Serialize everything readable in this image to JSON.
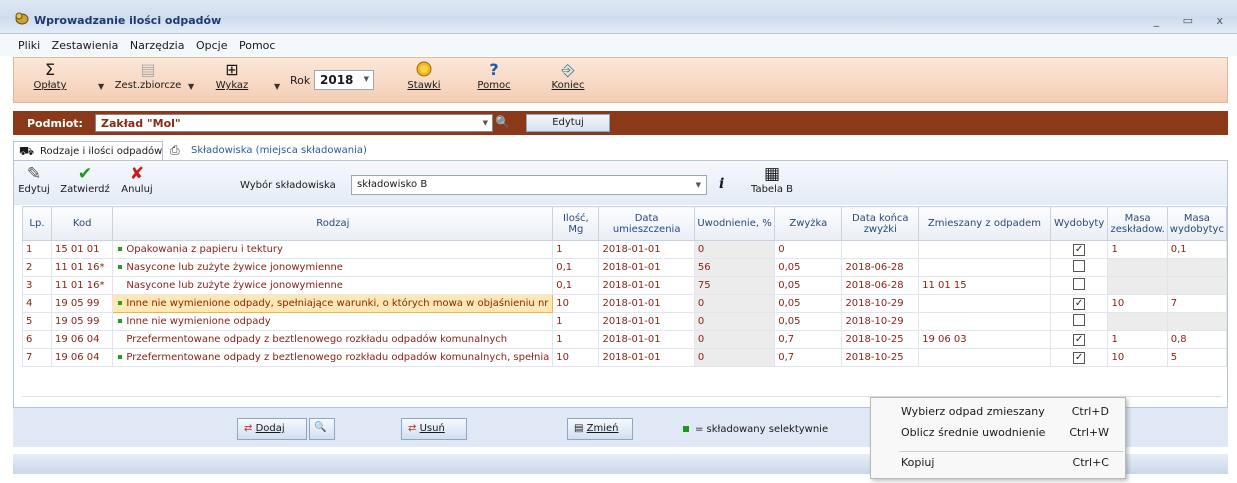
{
  "window": {
    "title": "Wprowadzanie ilości odpadów",
    "controls": "_ ▭ x"
  },
  "menu": [
    "Pliki",
    "Zestawienia",
    "Narzędzia",
    "Opcje",
    "Pomoc"
  ],
  "toolbar": {
    "oplaty": "Opłaty",
    "zest": "Zest.zbiorcze",
    "wykaz": "Wykaz",
    "rok_label": "Rok",
    "rok_value": "2018",
    "stawki": "Stawki",
    "pomoc": "Pomoc",
    "koniec": "Koniec"
  },
  "podmiot": {
    "label": "Podmiot:",
    "value": "Zakład \"Mol\"",
    "edit_btn": "Edytuj"
  },
  "tabs": [
    "Rodzaje i ilości odpadów",
    "Składowiska (miejsca składowania)"
  ],
  "subtoolbar": {
    "edytuj": "Edytuj",
    "zatwierdz": "Zatwierdź",
    "anuluj": "Anuluj",
    "wybor_label": "Wybór składowiska",
    "wybor_value": "składowisko B",
    "tabela": "Tabela B"
  },
  "table": {
    "headers": [
      "Lp.",
      "Kod",
      "Rodzaj",
      "Ilość, Mg",
      "Data umieszczenia",
      "Uwodnienie, %",
      "Zwyżka",
      "Data końca zwyżki",
      "Zmieszany z odpadem",
      "Wydobyty",
      "Masa zeskładow.",
      "Masa wydobytyc"
    ],
    "rows": [
      {
        "lp": "1",
        "kod": "15 01 01",
        "dot": true,
        "rodzaj": "Opakowania z papieru i tektury",
        "ilosc": "1",
        "data": "2018-01-01",
        "uwod": "0",
        "zwyzka": "0",
        "koniec": "",
        "zmieszany": "",
        "wydobyty": true,
        "masa_z": "1",
        "masa_w": "0,1"
      },
      {
        "lp": "2",
        "kod": "11 01 16*",
        "dot": true,
        "rodzaj": "Nasycone lub zużyte żywice jonowymienne",
        "ilosc": "0,1",
        "data": "2018-01-01",
        "uwod": "56",
        "zwyzka": "0,05",
        "koniec": "2018-06-28",
        "zmieszany": "",
        "wydobyty": false,
        "masa_z": "",
        "masa_w": ""
      },
      {
        "lp": "3",
        "kod": "11 01 16*",
        "dot": false,
        "rodzaj": "Nasycone lub zużyte żywice jonowymienne",
        "ilosc": "0,1",
        "data": "2018-01-01",
        "uwod": "75",
        "zwyzka": "0,05",
        "koniec": "2018-06-28",
        "zmieszany": "11 01 15",
        "wydobyty": false,
        "masa_z": "",
        "masa_w": ""
      },
      {
        "lp": "4",
        "kod": "19 05 99",
        "dot": true,
        "rodzaj": "Inne nie wymienione odpady, spełniające warunki, o których mowa w objaśnieniu nr",
        "ilosc": "10",
        "data": "2018-01-01",
        "uwod": "0",
        "zwyzka": "0,05",
        "koniec": "2018-10-29",
        "zmieszany": "",
        "wydobyty": true,
        "masa_z": "10",
        "masa_w": "7"
      },
      {
        "lp": "5",
        "kod": "19 05 99",
        "dot": true,
        "rodzaj": "Inne nie wymienione odpady",
        "ilosc": "1",
        "data": "2018-01-01",
        "uwod": "0",
        "zwyzka": "0,05",
        "koniec": "2018-10-29",
        "zmieszany": "",
        "wydobyty": false,
        "masa_z": "",
        "masa_w": ""
      },
      {
        "lp": "6",
        "kod": "19 06 04",
        "dot": false,
        "rodzaj": "Przefermentowane odpady z beztlenowego rozkładu odpadów komunalnych",
        "ilosc": "1",
        "data": "2018-01-01",
        "uwod": "0",
        "zwyzka": "0,7",
        "koniec": "2018-10-25",
        "zmieszany": "19 06 03",
        "wydobyty": true,
        "masa_z": "1",
        "masa_w": "0,8"
      },
      {
        "lp": "7",
        "kod": "19 06 04",
        "dot": true,
        "rodzaj": "Przefermentowane odpady z beztlenowego rozkładu odpadów komunalnych, spełnia",
        "ilosc": "10",
        "data": "2018-01-01",
        "uwod": "0",
        "zwyzka": "0,7",
        "koniec": "2018-10-25",
        "zmieszany": "",
        "wydobyty": true,
        "masa_z": "10",
        "masa_w": "5"
      }
    ]
  },
  "bottom": {
    "dodaj": "Dodaj",
    "usun": "Usuń",
    "zmien": "Zmień",
    "legend": "= składowany selektywnie"
  },
  "context_menu": [
    {
      "label": "Wybierz odpad zmieszany",
      "shortcut": "Ctrl+D"
    },
    {
      "label": "Oblicz średnie uwodnienie",
      "shortcut": "Ctrl+W"
    },
    {
      "label": "Kopiuj",
      "shortcut": "Ctrl+C"
    }
  ],
  "colors": {
    "podmiot_bar": "#8a3a18",
    "row_text": "#8a1f14",
    "selected_cell": "#ffe9b0",
    "selective_marker": "#1a9a1a"
  }
}
